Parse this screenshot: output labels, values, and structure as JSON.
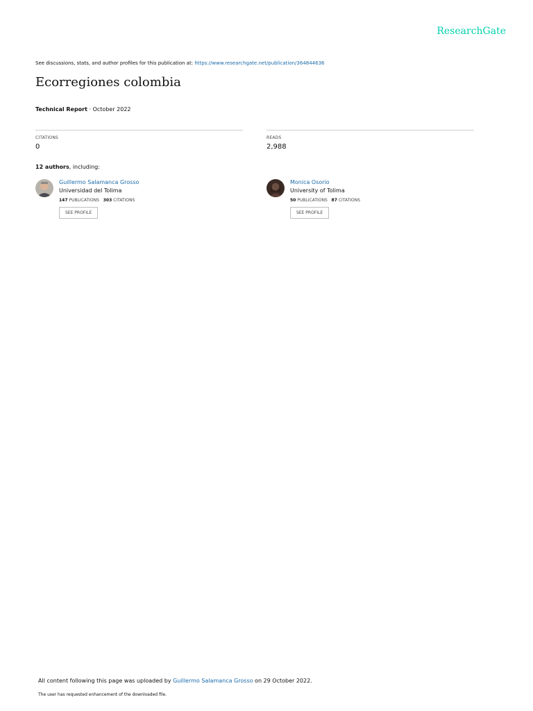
{
  "brand": {
    "logo": "ResearchGate",
    "color": "#00d0af"
  },
  "discussion": {
    "prefix": "See discussions, stats, and author profiles for this publication at:",
    "link": "https://www.researchgate.net/publication/364844636"
  },
  "publication": {
    "title": "Ecorregiones colombia",
    "type": "Technical Report",
    "separator": "·",
    "date": "October 2022"
  },
  "stats": {
    "citations": {
      "label": "CITATIONS",
      "value": "0"
    },
    "reads": {
      "label": "READS",
      "value": "2,988"
    }
  },
  "authors": {
    "count_bold": "12 authors",
    "suffix": ", including:",
    "list": [
      {
        "name": "Guillermo Salamanca Grosso",
        "institution": "Universidad del Tolima",
        "publications": "147",
        "publications_label": "PUBLICATIONS",
        "citations": "303",
        "citations_label": "CITATIONS",
        "button": "SEE PROFILE"
      },
      {
        "name": "Monica Osorio",
        "institution": "University of Tolima",
        "publications": "50",
        "publications_label": "PUBLICATIONS",
        "citations": "87",
        "citations_label": "CITATIONS",
        "button": "SEE PROFILE"
      }
    ]
  },
  "footer": {
    "uploaded_prefix": "All content following this page was uploaded by",
    "uploader": "Guillermo Salamanca Grosso",
    "uploaded_suffix": "on 29 October 2022.",
    "note": "The user has requested enhancement of the downloaded file."
  }
}
